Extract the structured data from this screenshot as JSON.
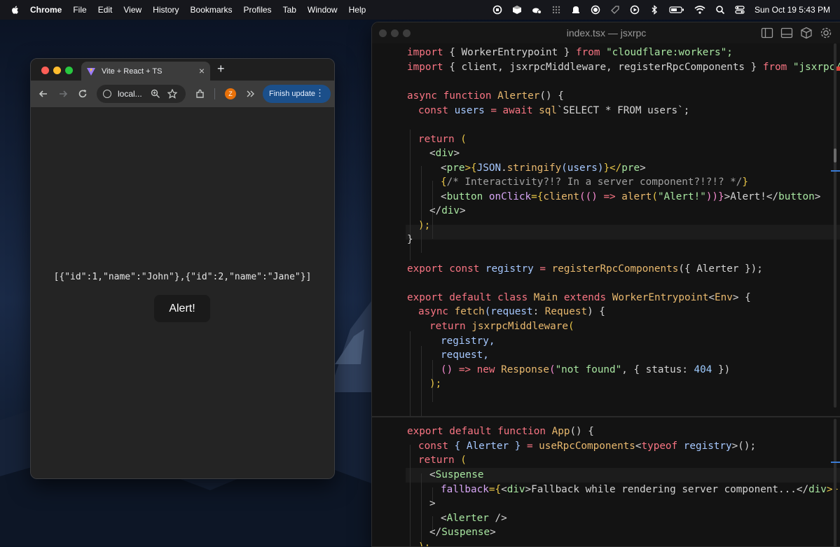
{
  "menubar": {
    "app_name": "Chrome",
    "items": [
      "File",
      "Edit",
      "View",
      "History",
      "Bookmarks",
      "Profiles",
      "Tab",
      "Window",
      "Help"
    ],
    "clock": "Sun Oct 19  5:43 PM",
    "status_icons": [
      "screen-share-icon",
      "cube-icon",
      "cloud-icon",
      "grid-icon",
      "notification-icon",
      "radio-icon",
      "tag-icon",
      "play-icon",
      "bluetooth-icon",
      "battery-icon",
      "wifi-icon",
      "search-icon",
      "control-center-icon"
    ]
  },
  "browser": {
    "tab_title": "Vite + React + TS",
    "url_text": "local...",
    "profile_initial": "Z",
    "finish_update_label": "Finish update",
    "page": {
      "json_output": "[{\"id\":1,\"name\":\"John\"},{\"id\":2,\"name\":\"Jane\"}]",
      "button_label": "Alert!"
    }
  },
  "editor": {
    "title": "index.tsx — jsxrpc",
    "lines": {
      "l1a": "import",
      "l1b": " { WorkerEntrypoint } ",
      "l1c": "from",
      "l1d": " \"cloudflare:workers\";",
      "l2a": "import",
      "l2b": " { client, jsxrpcMiddleware, registerRpcComponents } ",
      "l2c": "from",
      "l2d": " \"jsxrpc/se",
      "l3a": "async",
      "l3b": " function",
      "l3c": " Alerter",
      "l3d": "() {",
      "l4a": "const",
      "l4b": " users ",
      "l4c": "= await",
      "l4d": " sql",
      "l4e": "`SELECT * FROM users`",
      "l5a": "return",
      "l5b": " (",
      "l6a": "<",
      "l6b": "div",
      "l6c": ">",
      "l7a": "<",
      "l7b": "pre",
      "l7c": ">{",
      "l7d": "JSON",
      "l7e": ".",
      "l7f": "stringify",
      "l7g": "(users)",
      "l7h": "}</",
      "l7i": "pre",
      "l7j": ">",
      "l8a": "{",
      "l8b": "/* Interactivity?!? In a server component?!?!? */",
      "l8c": "}",
      "l9a": "<",
      "l9b": "button",
      "l9c": " onClick",
      "l9d": "={",
      "l9e": "client",
      "l9f": "(()",
      "l9g": " =>",
      "l9h": " alert",
      "l9i": "(",
      "l9j": "\"Alert!\"",
      "l9k": "))}",
      "l9l": ">Alert!</",
      "l9m": "button",
      "l9n": ">",
      "l10a": "</",
      "l10b": "div",
      "l10c": ">",
      "l11": ");",
      "l12": "}",
      "l13a": "export",
      "l13b": " const",
      "l13c": " registry ",
      "l13d": "=",
      "l13e": " registerRpcComponents",
      "l13f": "({ Alerter });",
      "l14a": "export",
      "l14b": " default",
      "l14c": " class",
      "l14d": " Main",
      "l14e": " extends",
      "l14f": " WorkerEntrypoint",
      "l14g": "<",
      "l14h": "Env",
      "l14i": "> {",
      "l15a": "async",
      "l15b": " fetch",
      "l15c": "(request",
      "l15d": ": ",
      "l15e": "Request",
      "l15f": ") {",
      "l16a": "return",
      "l16b": " jsxrpcMiddleware",
      "l16c": "(",
      "l17": "registry,",
      "l18": "request,",
      "l19a": "() ",
      "l19b": "=>",
      "l19c": " new",
      "l19d": " Response",
      "l19e": "(",
      "l19f": "\"not found\"",
      "l19g": ", { status: ",
      "l19h": "404",
      "l19i": " })",
      "l20": ");",
      "l21a": "export",
      "l21b": " default",
      "l21c": " function",
      "l21d": " App",
      "l21e": "() {",
      "l22a": "const",
      "l22b": " { Alerter } ",
      "l22c": "=",
      "l22d": " useRpcComponents",
      "l22e": "<",
      "l22f": "typeof",
      "l22g": " registry",
      "l22h": ">();",
      "l23a": "return",
      "l23b": " (",
      "l24a": "<",
      "l24b": "Suspense",
      "l25a": "fallback",
      "l25b": "={",
      "l25c": "<",
      "l25d": "div",
      "l25e": ">Fallback while rendering server component...</",
      "l25f": "div",
      "l25g": ">}",
      "l26": ">",
      "l27a": "<",
      "l27b": "Alerter",
      "l27c": " />",
      "l28a": "</",
      "l28b": "Suspense",
      "l28c": ">",
      "l29": ");",
      "l30": "}"
    }
  },
  "colors": {
    "keyword": "#f97583",
    "function": "#e9b96e",
    "string": "#a8e6a1",
    "accent_blue": "#3a7bd5",
    "finish_update_bg": "#1b4f8a"
  }
}
